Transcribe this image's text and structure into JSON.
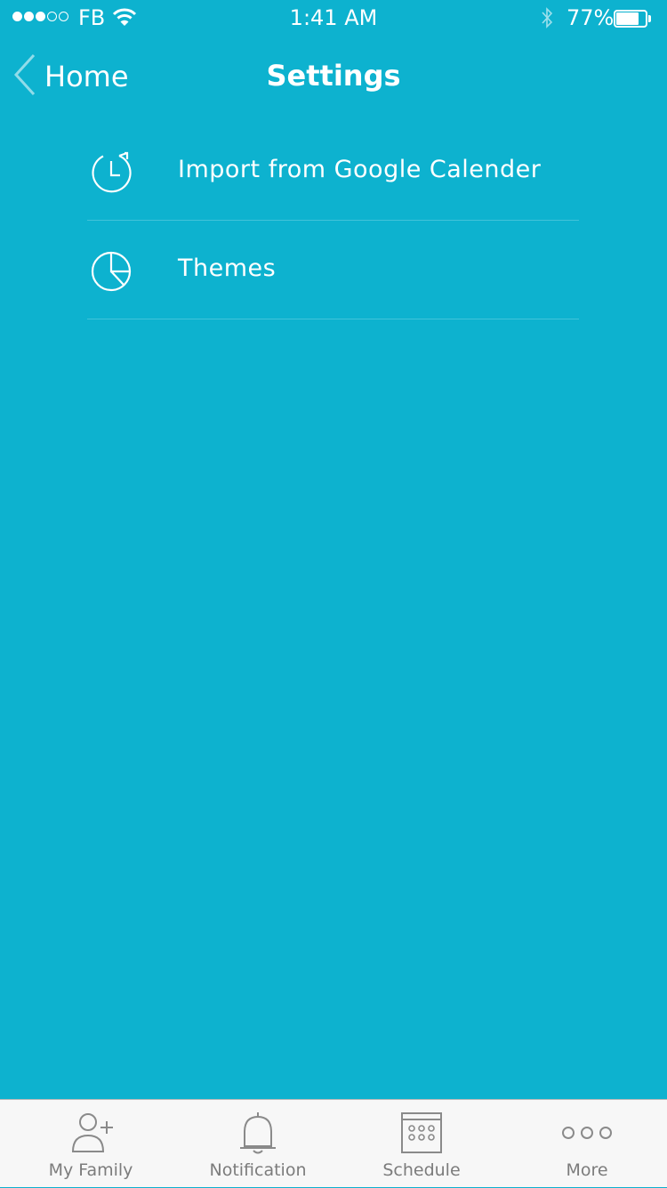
{
  "status_bar": {
    "carrier": "FB",
    "time": "1:41 AM",
    "battery_percent": "77%",
    "battery_level": 0.77,
    "signal_strength": 3,
    "signal_max": 5
  },
  "nav": {
    "back_label": "Home",
    "title": "Settings"
  },
  "settings": {
    "items": [
      {
        "label": "Import from Google Calender",
        "icon": "calendar-import-icon"
      },
      {
        "label": "Themes",
        "icon": "pie-chart-icon"
      }
    ]
  },
  "tab_bar": {
    "tabs": [
      {
        "label": "My Family",
        "icon": "add-person-icon"
      },
      {
        "label": "Notification",
        "icon": "bell-icon"
      },
      {
        "label": "Schedule",
        "icon": "calendar-grid-icon"
      },
      {
        "label": "More",
        "icon": "more-dots-icon"
      }
    ]
  },
  "colors": {
    "background": "#0db2cf",
    "tab_bar": "#f7f7f7",
    "tab_inactive": "#7c7c7c",
    "text": "#ffffff"
  }
}
